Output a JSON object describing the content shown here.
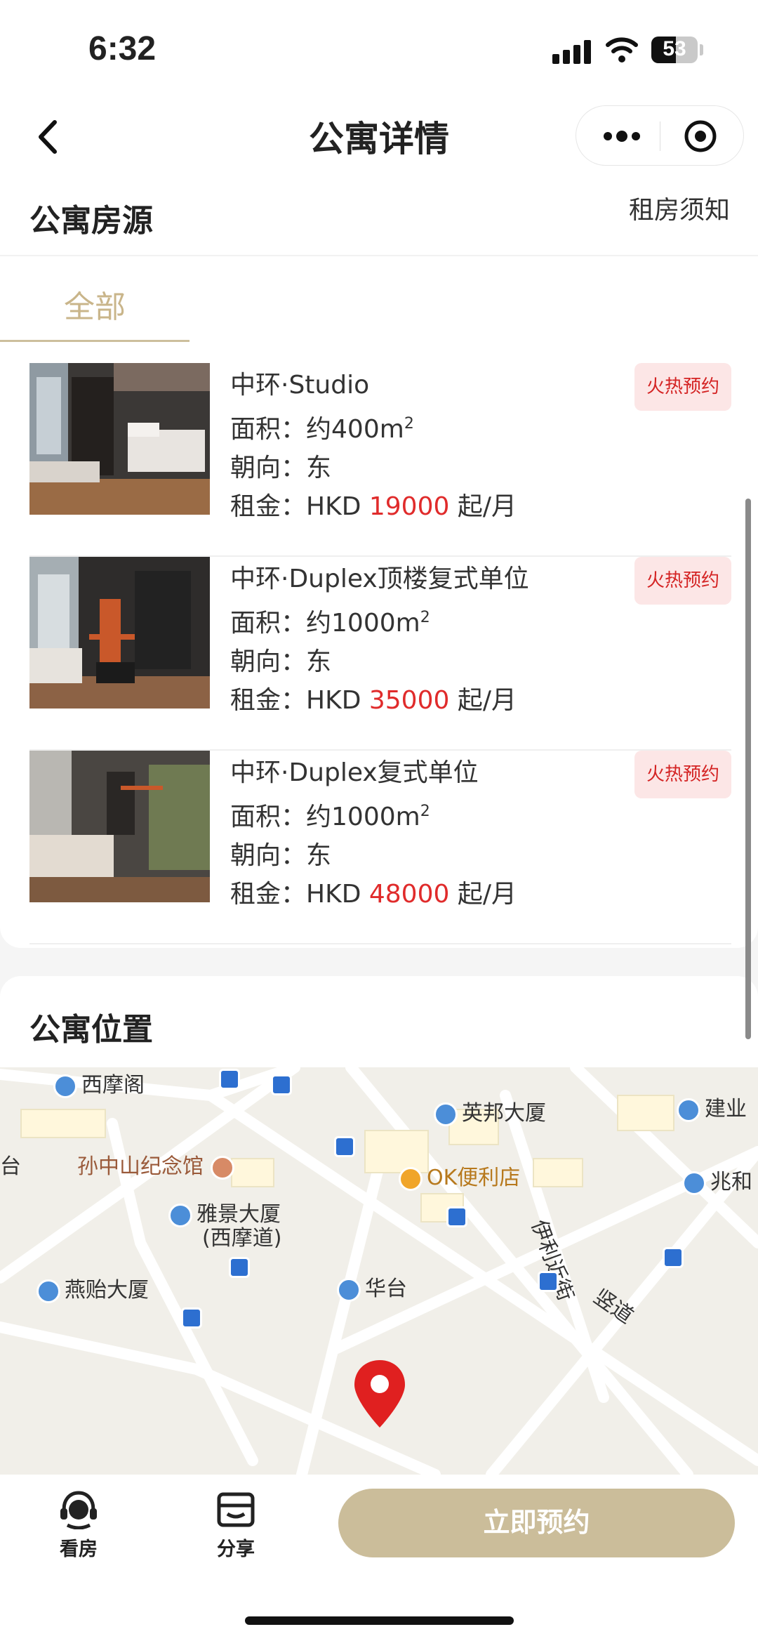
{
  "status_bar": {
    "time": "6:32",
    "battery": "53"
  },
  "nav": {
    "title": "公寓详情"
  },
  "listings_section": {
    "title": "公寓房源",
    "notice_link": "租房须知",
    "tab_all": "全部",
    "items": [
      {
        "name": "中环·Studio",
        "area_label": "面积：",
        "area_value": "约400m",
        "area_sup": "2",
        "orient_label": "朝向：",
        "orient_value": "东",
        "rent_label": "租金：",
        "rent_currency": "HKD ",
        "rent_value": "19000",
        "rent_suffix": " 起/月",
        "badge": "火热预约"
      },
      {
        "name": "中环·Duplex顶楼复式单位",
        "area_label": "面积：",
        "area_value": "约1000m",
        "area_sup": "2",
        "orient_label": "朝向：",
        "orient_value": "东",
        "rent_label": "租金：",
        "rent_currency": "HKD ",
        "rent_value": "35000",
        "rent_suffix": " 起/月",
        "badge": "火热预约"
      },
      {
        "name": "中环·Duplex复式单位",
        "area_label": "面积：",
        "area_value": "约1000m",
        "area_sup": "2",
        "orient_label": "朝向：",
        "orient_value": "东",
        "rent_label": "租金：",
        "rent_currency": "HKD ",
        "rent_value": "48000",
        "rent_suffix": " 起/月",
        "badge": "火热预约"
      }
    ]
  },
  "location_section": {
    "title": "公寓位置",
    "map_labels": {
      "xi_mo_ge": "西摩阁",
      "sun_yat_sen": "孙中山纪念馆",
      "ying_bang": "英邦大厦",
      "jian_ye": "建业",
      "ok_store": "OK便利店",
      "zhao_he": "兆和",
      "ya_jing_1": "雅景大厦",
      "ya_jing_2": "(西摩道)",
      "yan_yi": "燕贻大厦",
      "hua_tai": "华台",
      "yi_li_jin": "伊利近街",
      "shu_dao": "竖道",
      "tai": "台"
    }
  },
  "bottom_bar": {
    "view_label": "看房",
    "share_label": "分享",
    "book_label": "立即预约"
  }
}
